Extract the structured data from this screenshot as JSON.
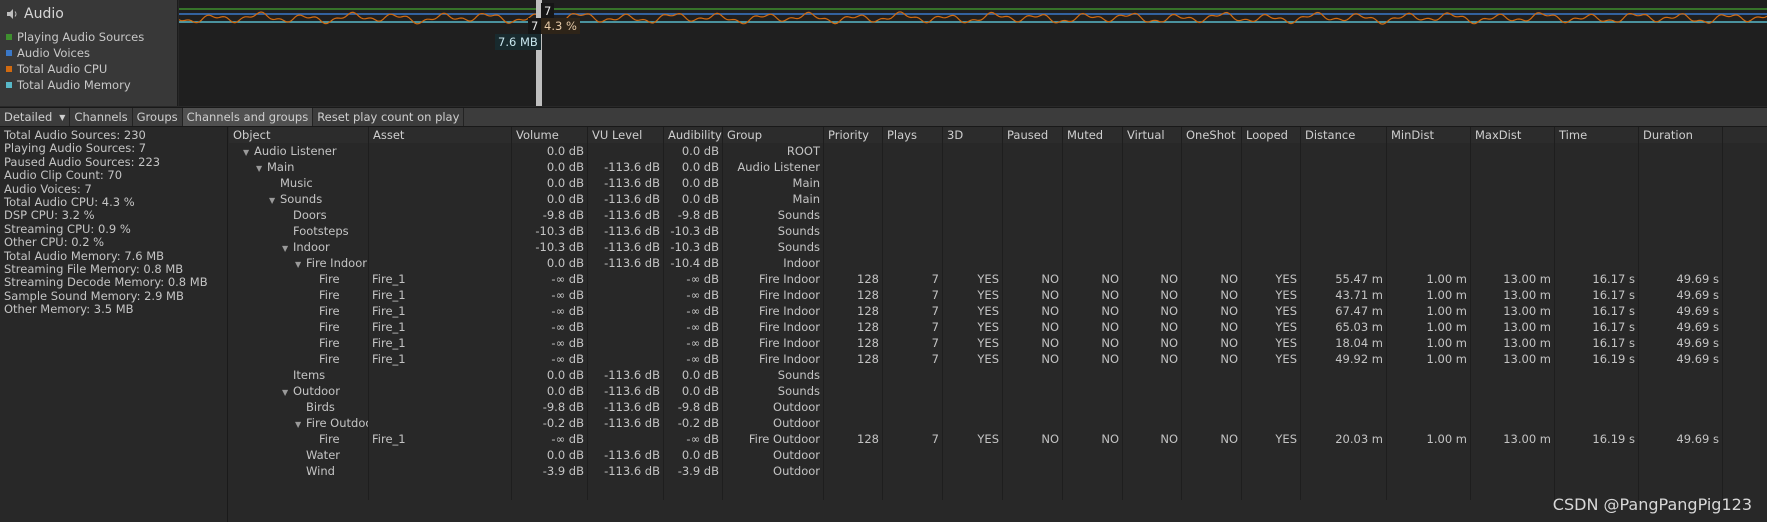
{
  "graph": {
    "title": "Audio",
    "legend": [
      {
        "label": "Playing Audio Sources",
        "color": "#3f8f2f"
      },
      {
        "label": "Audio Voices",
        "color": "#3a78c8"
      },
      {
        "label": "Total Audio CPU",
        "color": "#d06a10"
      },
      {
        "label": "Total Audio Memory",
        "color": "#58b8c8"
      }
    ],
    "tooltips": {
      "playing": "7",
      "voices": "7",
      "cpu": "4.3 %",
      "memory": "7.6 MB"
    }
  },
  "toolbar": {
    "mode": "Detailed",
    "tabs": [
      "Channels",
      "Groups",
      "Channels and groups"
    ],
    "active_tab": "Channels and groups",
    "reset_button": "Reset play count on play"
  },
  "stats": [
    "Total Audio Sources: 230",
    "Playing Audio Sources: 7",
    "Paused Audio Sources: 223",
    "Audio Clip Count: 70",
    "Audio Voices: 7",
    "Total Audio CPU: 4.3 %",
    "DSP CPU: 3.2 %",
    "Streaming CPU: 0.9 %",
    "Other CPU: 0.2 %",
    "Total Audio Memory: 7.6 MB",
    "Streaming File Memory: 0.8 MB",
    "Streaming Decode Memory: 0.8 MB",
    "Sample Sound Memory: 2.9 MB",
    "Other Memory: 3.5 MB"
  ],
  "columns": [
    "Object",
    "Asset",
    "Volume",
    "VU Level",
    "Audibility",
    "Group",
    "Priority",
    "Plays",
    "3D",
    "Paused",
    "Muted",
    "Virtual",
    "OneShot",
    "Looped",
    "Distance",
    "MinDist",
    "MaxDist",
    "Time",
    "Duration"
  ],
  "rows": [
    {
      "depth": 0,
      "expand": "open",
      "object": "Audio Listener",
      "asset": "",
      "volume": "0.0 dB",
      "vu": "",
      "aud": "0.0 dB",
      "group": "ROOT",
      "priority": "",
      "plays": "",
      "d3": "",
      "paused": "",
      "muted": "",
      "virtual": "",
      "oneshot": "",
      "looped": "",
      "distance": "",
      "mindist": "",
      "maxdist": "",
      "time": "",
      "duration": ""
    },
    {
      "depth": 1,
      "expand": "open",
      "object": "Main",
      "asset": "",
      "volume": "0.0 dB",
      "vu": "-113.6 dB",
      "aud": "0.0 dB",
      "group": "Audio Listener",
      "priority": "",
      "plays": "",
      "d3": "",
      "paused": "",
      "muted": "",
      "virtual": "",
      "oneshot": "",
      "looped": "",
      "distance": "",
      "mindist": "",
      "maxdist": "",
      "time": "",
      "duration": ""
    },
    {
      "depth": 2,
      "expand": "",
      "object": "Music",
      "asset": "",
      "volume": "0.0 dB",
      "vu": "-113.6 dB",
      "aud": "0.0 dB",
      "group": "Main",
      "priority": "",
      "plays": "",
      "d3": "",
      "paused": "",
      "muted": "",
      "virtual": "",
      "oneshot": "",
      "looped": "",
      "distance": "",
      "mindist": "",
      "maxdist": "",
      "time": "",
      "duration": ""
    },
    {
      "depth": 2,
      "expand": "open",
      "object": "Sounds",
      "asset": "",
      "volume": "0.0 dB",
      "vu": "-113.6 dB",
      "aud": "0.0 dB",
      "group": "Main",
      "priority": "",
      "plays": "",
      "d3": "",
      "paused": "",
      "muted": "",
      "virtual": "",
      "oneshot": "",
      "looped": "",
      "distance": "",
      "mindist": "",
      "maxdist": "",
      "time": "",
      "duration": ""
    },
    {
      "depth": 3,
      "expand": "",
      "object": "Doors",
      "asset": "",
      "volume": "-9.8 dB",
      "vu": "-113.6 dB",
      "aud": "-9.8 dB",
      "group": "Sounds",
      "priority": "",
      "plays": "",
      "d3": "",
      "paused": "",
      "muted": "",
      "virtual": "",
      "oneshot": "",
      "looped": "",
      "distance": "",
      "mindist": "",
      "maxdist": "",
      "time": "",
      "duration": ""
    },
    {
      "depth": 3,
      "expand": "",
      "object": "Footsteps",
      "asset": "",
      "volume": "-10.3 dB",
      "vu": "-113.6 dB",
      "aud": "-10.3 dB",
      "group": "Sounds",
      "priority": "",
      "plays": "",
      "d3": "",
      "paused": "",
      "muted": "",
      "virtual": "",
      "oneshot": "",
      "looped": "",
      "distance": "",
      "mindist": "",
      "maxdist": "",
      "time": "",
      "duration": ""
    },
    {
      "depth": 3,
      "expand": "open",
      "object": "Indoor",
      "asset": "",
      "volume": "-10.3 dB",
      "vu": "-113.6 dB",
      "aud": "-10.3 dB",
      "group": "Sounds",
      "priority": "",
      "plays": "",
      "d3": "",
      "paused": "",
      "muted": "",
      "virtual": "",
      "oneshot": "",
      "looped": "",
      "distance": "",
      "mindist": "",
      "maxdist": "",
      "time": "",
      "duration": ""
    },
    {
      "depth": 4,
      "expand": "open",
      "object": "Fire Indoor",
      "asset": "",
      "volume": "0.0 dB",
      "vu": "-113.6 dB",
      "aud": "-10.4 dB",
      "group": "Indoor",
      "priority": "",
      "plays": "",
      "d3": "",
      "paused": "",
      "muted": "",
      "virtual": "",
      "oneshot": "",
      "looped": "",
      "distance": "",
      "mindist": "",
      "maxdist": "",
      "time": "",
      "duration": ""
    },
    {
      "depth": 5,
      "expand": "",
      "object": "Fire",
      "asset": "Fire_1",
      "volume": "-∞ dB",
      "vu": "",
      "aud": "-∞ dB",
      "group": "Fire Indoor",
      "priority": "128",
      "plays": "7",
      "d3": "YES",
      "paused": "NO",
      "muted": "NO",
      "virtual": "NO",
      "oneshot": "NO",
      "looped": "YES",
      "distance": "55.47 m",
      "mindist": "1.00 m",
      "maxdist": "13.00 m",
      "time": "16.17 s",
      "duration": "49.69 s"
    },
    {
      "depth": 5,
      "expand": "",
      "object": "Fire",
      "asset": "Fire_1",
      "volume": "-∞ dB",
      "vu": "",
      "aud": "-∞ dB",
      "group": "Fire Indoor",
      "priority": "128",
      "plays": "7",
      "d3": "YES",
      "paused": "NO",
      "muted": "NO",
      "virtual": "NO",
      "oneshot": "NO",
      "looped": "YES",
      "distance": "43.71 m",
      "mindist": "1.00 m",
      "maxdist": "13.00 m",
      "time": "16.17 s",
      "duration": "49.69 s"
    },
    {
      "depth": 5,
      "expand": "",
      "object": "Fire",
      "asset": "Fire_1",
      "volume": "-∞ dB",
      "vu": "",
      "aud": "-∞ dB",
      "group": "Fire Indoor",
      "priority": "128",
      "plays": "7",
      "d3": "YES",
      "paused": "NO",
      "muted": "NO",
      "virtual": "NO",
      "oneshot": "NO",
      "looped": "YES",
      "distance": "67.47 m",
      "mindist": "1.00 m",
      "maxdist": "13.00 m",
      "time": "16.17 s",
      "duration": "49.69 s"
    },
    {
      "depth": 5,
      "expand": "",
      "object": "Fire",
      "asset": "Fire_1",
      "volume": "-∞ dB",
      "vu": "",
      "aud": "-∞ dB",
      "group": "Fire Indoor",
      "priority": "128",
      "plays": "7",
      "d3": "YES",
      "paused": "NO",
      "muted": "NO",
      "virtual": "NO",
      "oneshot": "NO",
      "looped": "YES",
      "distance": "65.03 m",
      "mindist": "1.00 m",
      "maxdist": "13.00 m",
      "time": "16.17 s",
      "duration": "49.69 s"
    },
    {
      "depth": 5,
      "expand": "",
      "object": "Fire",
      "asset": "Fire_1",
      "volume": "-∞ dB",
      "vu": "",
      "aud": "-∞ dB",
      "group": "Fire Indoor",
      "priority": "128",
      "plays": "7",
      "d3": "YES",
      "paused": "NO",
      "muted": "NO",
      "virtual": "NO",
      "oneshot": "NO",
      "looped": "YES",
      "distance": "18.04 m",
      "mindist": "1.00 m",
      "maxdist": "13.00 m",
      "time": "16.17 s",
      "duration": "49.69 s"
    },
    {
      "depth": 5,
      "expand": "",
      "object": "Fire",
      "asset": "Fire_1",
      "volume": "-∞ dB",
      "vu": "",
      "aud": "-∞ dB",
      "group": "Fire Indoor",
      "priority": "128",
      "plays": "7",
      "d3": "YES",
      "paused": "NO",
      "muted": "NO",
      "virtual": "NO",
      "oneshot": "NO",
      "looped": "YES",
      "distance": "49.92 m",
      "mindist": "1.00 m",
      "maxdist": "13.00 m",
      "time": "16.19 s",
      "duration": "49.69 s"
    },
    {
      "depth": 3,
      "expand": "",
      "object": "Items",
      "asset": "",
      "volume": "0.0 dB",
      "vu": "-113.6 dB",
      "aud": "0.0 dB",
      "group": "Sounds",
      "priority": "",
      "plays": "",
      "d3": "",
      "paused": "",
      "muted": "",
      "virtual": "",
      "oneshot": "",
      "looped": "",
      "distance": "",
      "mindist": "",
      "maxdist": "",
      "time": "",
      "duration": ""
    },
    {
      "depth": 3,
      "expand": "open",
      "object": "Outdoor",
      "asset": "",
      "volume": "0.0 dB",
      "vu": "-113.6 dB",
      "aud": "0.0 dB",
      "group": "Sounds",
      "priority": "",
      "plays": "",
      "d3": "",
      "paused": "",
      "muted": "",
      "virtual": "",
      "oneshot": "",
      "looped": "",
      "distance": "",
      "mindist": "",
      "maxdist": "",
      "time": "",
      "duration": ""
    },
    {
      "depth": 4,
      "expand": "",
      "object": "Birds",
      "asset": "",
      "volume": "-9.8 dB",
      "vu": "-113.6 dB",
      "aud": "-9.8 dB",
      "group": "Outdoor",
      "priority": "",
      "plays": "",
      "d3": "",
      "paused": "",
      "muted": "",
      "virtual": "",
      "oneshot": "",
      "looped": "",
      "distance": "",
      "mindist": "",
      "maxdist": "",
      "time": "",
      "duration": ""
    },
    {
      "depth": 4,
      "expand": "open",
      "object": "Fire Outdoor",
      "asset": "",
      "volume": "-0.2 dB",
      "vu": "-113.6 dB",
      "aud": "-0.2 dB",
      "group": "Outdoor",
      "priority": "",
      "plays": "",
      "d3": "",
      "paused": "",
      "muted": "",
      "virtual": "",
      "oneshot": "",
      "looped": "",
      "distance": "",
      "mindist": "",
      "maxdist": "",
      "time": "",
      "duration": ""
    },
    {
      "depth": 5,
      "expand": "",
      "object": "Fire",
      "asset": "Fire_1",
      "volume": "-∞ dB",
      "vu": "",
      "aud": "-∞ dB",
      "group": "Fire Outdoor",
      "priority": "128",
      "plays": "7",
      "d3": "YES",
      "paused": "NO",
      "muted": "NO",
      "virtual": "NO",
      "oneshot": "NO",
      "looped": "YES",
      "distance": "20.03 m",
      "mindist": "1.00 m",
      "maxdist": "13.00 m",
      "time": "16.19 s",
      "duration": "49.69 s"
    },
    {
      "depth": 4,
      "expand": "",
      "object": "Water",
      "asset": "",
      "volume": "0.0 dB",
      "vu": "-113.6 dB",
      "aud": "0.0 dB",
      "group": "Outdoor",
      "priority": "",
      "plays": "",
      "d3": "",
      "paused": "",
      "muted": "",
      "virtual": "",
      "oneshot": "",
      "looped": "",
      "distance": "",
      "mindist": "",
      "maxdist": "",
      "time": "",
      "duration": ""
    },
    {
      "depth": 4,
      "expand": "",
      "object": "Wind",
      "asset": "",
      "volume": "-3.9 dB",
      "vu": "-113.6 dB",
      "aud": "-3.9 dB",
      "group": "Outdoor",
      "priority": "",
      "plays": "",
      "d3": "",
      "paused": "",
      "muted": "",
      "virtual": "",
      "oneshot": "",
      "looped": "",
      "distance": "",
      "mindist": "",
      "maxdist": "",
      "time": "",
      "duration": ""
    }
  ],
  "watermark": "CSDN @PangPangPig123"
}
